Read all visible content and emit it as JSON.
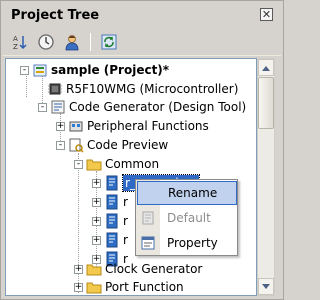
{
  "panel": {
    "title": "Project Tree"
  },
  "toolbar": {
    "buttons": [
      "sort-icon",
      "clock-icon",
      "user-icon",
      "refresh-icon"
    ]
  },
  "tree": {
    "items": [
      {
        "label": "sample (Project)*",
        "bold": true,
        "expander": "-"
      },
      {
        "label": "R5F10WMG (Microcontroller)"
      },
      {
        "label": "Code Generator (Design Tool)",
        "expander": "-"
      },
      {
        "label": "Peripheral Functions",
        "expander": "+"
      },
      {
        "label": "Code Preview",
        "expander": "-"
      },
      {
        "label": "Common",
        "expander": "-"
      },
      {
        "label": "r_cg_main.c",
        "expander": "+",
        "selected": true
      },
      {
        "label": "r",
        "expander": "+"
      },
      {
        "label": "r",
        "expander": "+"
      },
      {
        "label": "r",
        "expander": "+"
      },
      {
        "label": "r",
        "expander": "+"
      },
      {
        "label": "Clock Generator",
        "expander": "+"
      },
      {
        "label": "Port Function",
        "expander": "+"
      }
    ]
  },
  "context_menu": {
    "items": [
      {
        "label": "Rename",
        "state": "hover"
      },
      {
        "label": "Default",
        "state": "disabled"
      },
      {
        "label": "Property",
        "state": "normal"
      }
    ]
  },
  "colors": {
    "selection": "#316ac5",
    "menu_hover": "#c1d2ee",
    "folder": "#f2c94c"
  }
}
